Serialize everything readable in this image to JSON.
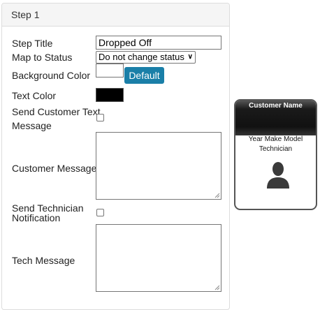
{
  "panel": {
    "title": "Step 1"
  },
  "form": {
    "step_title_label": "Step Title",
    "step_title_value": "Dropped Off",
    "map_status_label": "Map to Status",
    "map_status_value": "Do not change status",
    "bg_color_label": "Background Color",
    "default_button": "Default",
    "text_color_label": "Text Color",
    "send_customer_text_label_1": "Send Customer Text",
    "send_customer_text_label_2": "Message",
    "customer_message_label": "Customer Message",
    "send_tech_label_1": "Send Technician",
    "send_tech_label_2": "Notification",
    "tech_message_label": "Tech Message",
    "bg_color_value": "#ffffff",
    "text_color_value": "#000000"
  },
  "preview": {
    "customer_name": "Customer Name",
    "vehicle": "Year Make Model",
    "technician": "Technician"
  },
  "colors": {
    "accent": "#1a7fa8"
  }
}
